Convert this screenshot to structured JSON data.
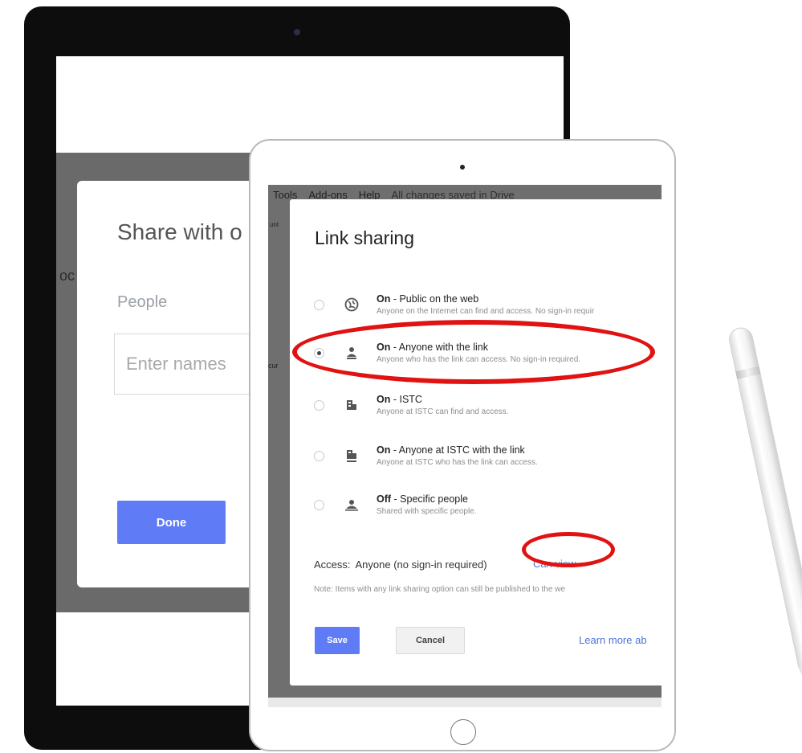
{
  "back_ipad": {
    "side_text": "oc",
    "side_text2": "cur",
    "dialog": {
      "title": "Share with o",
      "people_label": "People",
      "input_placeholder": "Enter names",
      "done_label": "Done"
    }
  },
  "front_ipad": {
    "menu": {
      "items": [
        "Tools",
        "Add-ons",
        "Help"
      ],
      "status": "All changes saved in Drive"
    },
    "side_text": "unt",
    "side_text2": "cur",
    "dialog": {
      "title": "Link sharing",
      "options": [
        {
          "title_bold": "On",
          "title_rest": " - Public on the web",
          "desc": "Anyone on the Internet can find and access. No sign-in requir",
          "icon": "globe-icon",
          "selected": false
        },
        {
          "title_bold": "On",
          "title_rest": " - Anyone with the link",
          "desc": "Anyone who has the link can access. No sign-in required.",
          "icon": "person-link-icon",
          "selected": true
        },
        {
          "title_bold": "On",
          "title_rest": " - ISTC",
          "desc": "Anyone at ISTC can find and access.",
          "icon": "building-icon",
          "selected": false
        },
        {
          "title_bold": "On",
          "title_rest": " - Anyone at ISTC with the link",
          "desc": "Anyone at ISTC who has the link can access.",
          "icon": "building-link-icon",
          "selected": false
        },
        {
          "title_bold": "Off",
          "title_rest": " - Specific people",
          "desc": "Shared with specific people.",
          "icon": "person-off-icon",
          "selected": false
        }
      ],
      "access_label": "Access:",
      "access_value": "Anyone (no sign-in required)",
      "can_view_label": "Can view",
      "note": "Note: Items with any link sharing option can still be published to the we",
      "save_label": "Save",
      "cancel_label": "Cancel",
      "learn_more_label": "Learn more ab"
    }
  },
  "colors": {
    "accent_blue": "#5f7bf5",
    "link_blue": "#4a74d8",
    "annotation_red": "#e01212"
  }
}
